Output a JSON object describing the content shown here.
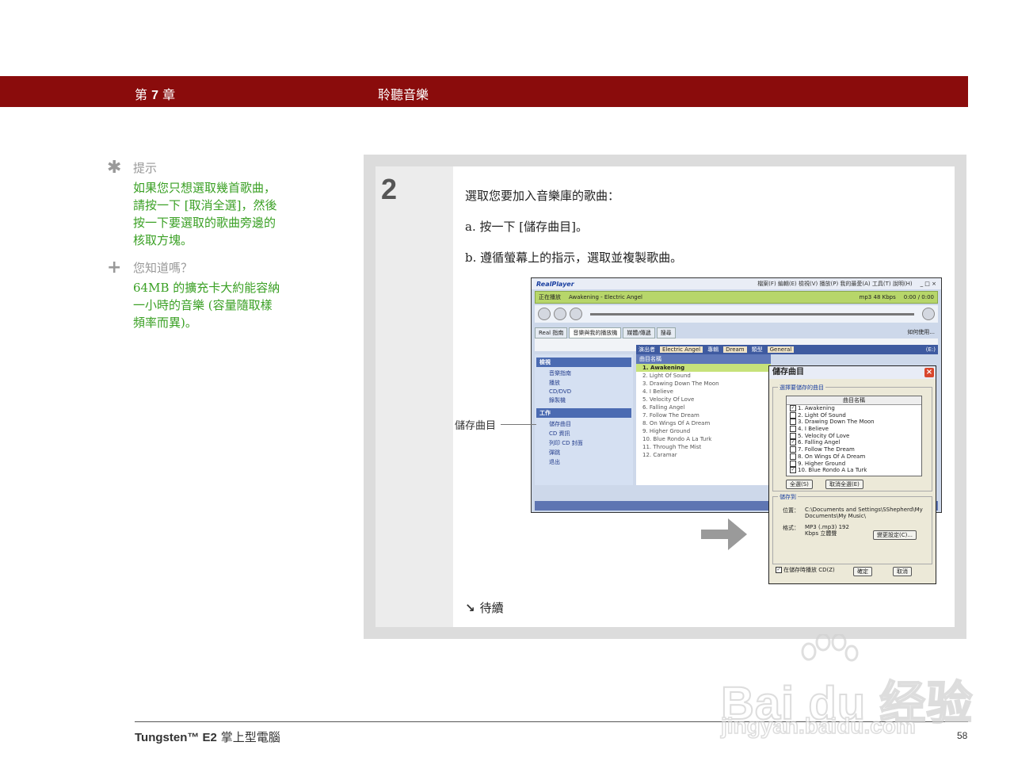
{
  "header": {
    "chapter_prefix": "第",
    "chapter_num": "7",
    "chapter_suffix": "章",
    "title": "聆聽音樂"
  },
  "tips": [
    {
      "label": "提示",
      "lines": [
        "如果您只想選取幾首歌曲，",
        "請按一下 [取消全選]，然後",
        "按一下要選取的歌曲旁邊的",
        "核取方塊。"
      ]
    },
    {
      "label": "您知道嗎？",
      "lines": [
        "64MB 的擴充卡大約能容納",
        "一小時的音樂 (容量隨取樣",
        "頻率而異)。"
      ]
    }
  ],
  "step": {
    "number": "2",
    "intro": "選取您要加入音樂庫的歌曲：",
    "a": "a.  按一下 [儲存曲目]。",
    "b": "b.  遵循螢幕上的指示，選取並複製歌曲。",
    "callout": "儲存曲目",
    "continued": "待續"
  },
  "screenshot": {
    "app": "RealPlayer",
    "menus": "檔案(F) 編輯(E) 檢視(V) 播放(P) 我的最愛(A) 工具(T) 說明(H)",
    "now_playing_label": "正在播放",
    "now_playing": "Awakening - Electric Angel",
    "format": "mp3 48 Kbps",
    "time": "0:00 / 0:00",
    "tabs": [
      "Real 指南",
      "音樂與我的播放機",
      "媒體/傳遞",
      "搜尋"
    ],
    "help": "如何使用...",
    "meta": {
      "artist_label": "演出者",
      "artist": "Electric Angel",
      "album_label": "專輯",
      "album": "Dream",
      "genre_label": "類型",
      "genre": "General",
      "drive": "(E:)"
    },
    "side_sections": [
      {
        "title": "檢視",
        "items": [
          "音樂指南",
          "播放",
          "CD/DVD",
          "錄製機"
        ]
      },
      {
        "title": "工作",
        "items": [
          "儲存曲目",
          "CD 資訊",
          "列印 CD 封面",
          "彈跳",
          "退出"
        ]
      }
    ],
    "list_header": "曲目名稱",
    "tracks": [
      "1. Awakening",
      "2. Light Of Sound",
      "3. Drawing Down The Moon",
      "4. I Believe",
      "5. Velocity Of Love",
      "6. Falling Angel",
      "7. Follow The Dream",
      "8. On Wings Of A Dream",
      "9. Higher Ground",
      "10. Blue Rondo A La Turk",
      "11. Through The Mist",
      "12. Caramar"
    ]
  },
  "dialog": {
    "title": "儲存曲目",
    "group_select": "選擇要儲存的曲目",
    "col_header": "曲目名稱",
    "songs": [
      {
        "name": "1. Awakening",
        "checked": true
      },
      {
        "name": "2. Light Of Sound",
        "checked": false
      },
      {
        "name": "3. Drawing Down The Moon",
        "checked": false
      },
      {
        "name": "4. I Believe",
        "checked": false
      },
      {
        "name": "5. Velocity Of Love",
        "checked": false
      },
      {
        "name": "6. Falling Angel",
        "checked": true
      },
      {
        "name": "7. Follow The Dream",
        "checked": false
      },
      {
        "name": "8. On Wings Of A Dream",
        "checked": false
      },
      {
        "name": "9. Higher Ground",
        "checked": false
      },
      {
        "name": "10. Blue Rondo A La Turk",
        "checked": true
      }
    ],
    "select_all": "全選(S)",
    "deselect_all": "取消全選(E)",
    "group_save": "儲存到",
    "location_label": "位置：",
    "location": "C:\\Documents and Settings\\SShepherd\\My Documents\\My Music\\",
    "format_label": "格式：",
    "format": "MP3 (.mp3) 192 Kbps 立體聲",
    "change_settings": "變更設定(C)...",
    "play_while_saving": "在儲存時播放 CD(Z)",
    "ok": "確定",
    "cancel": "取消"
  },
  "footer": {
    "brand": "Tungsten™ E2",
    "product": "掌上型電腦",
    "page": "58"
  },
  "watermark": {
    "line1": "Bai du 经验",
    "line2": "jingyan.baidu.com"
  }
}
